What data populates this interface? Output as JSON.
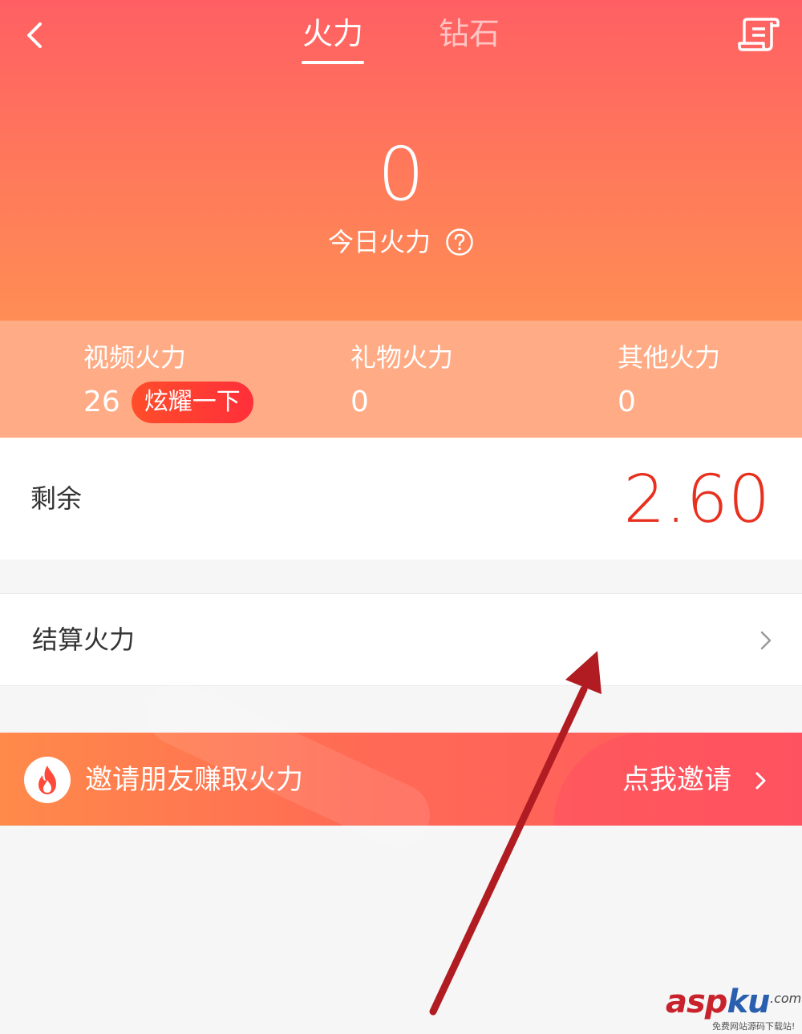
{
  "header": {
    "tabs": [
      {
        "label": "火力",
        "active": true
      },
      {
        "label": "钻石",
        "active": false
      }
    ],
    "back_icon": "chevron-left-icon",
    "record_icon": "scroll-icon"
  },
  "summary": {
    "today_value": "0",
    "today_label": "今日火力",
    "help_icon": "question-circle-icon"
  },
  "stats": [
    {
      "label": "视频火力",
      "value": "26",
      "badge": "炫耀一下"
    },
    {
      "label": "礼物火力",
      "value": "0"
    },
    {
      "label": "其他火力",
      "value": "0"
    }
  ],
  "balance": {
    "label": "剩余",
    "value": "2.60"
  },
  "settle": {
    "label": "结算火力"
  },
  "invite": {
    "label": "邀请朋友赚取火力",
    "action": "点我邀请"
  },
  "watermark": {
    "main_a": "asp",
    "main_b": "ku",
    "suffix": ".com",
    "sub": "免费网站源码下载站!"
  },
  "colors": {
    "brand_gradient_top": "#ff5f63",
    "brand_gradient_bottom": "#ff8d55",
    "stats_bg": "#ffac86",
    "balance_value": "#e8301f",
    "arrow": "#b01c22"
  }
}
